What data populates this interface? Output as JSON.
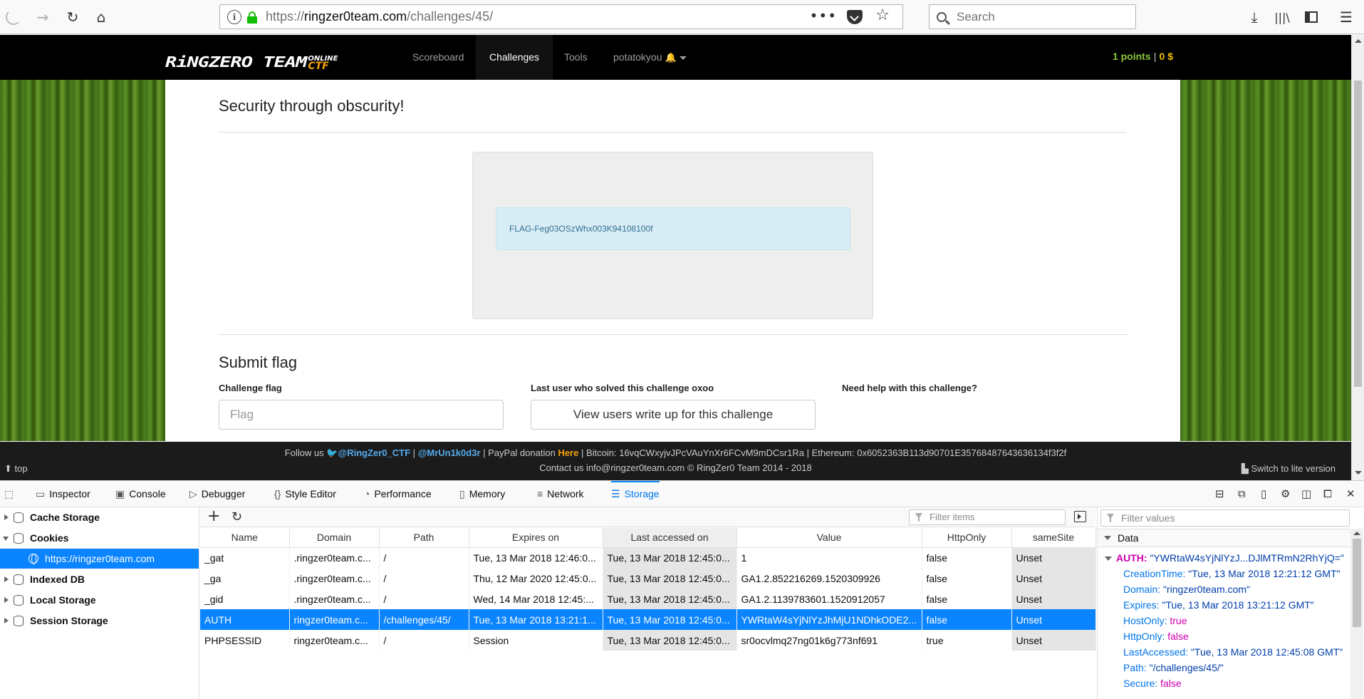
{
  "browser": {
    "url_prefix": "https://",
    "url_host": "ringzer0team.com",
    "url_path": "/challenges/45/",
    "search_placeholder": "Search",
    "url_more": "•••"
  },
  "site": {
    "logo_main": "RiNGZERO TEAM",
    "logo_online": "ONLINE",
    "logo_ctf": "CTF",
    "nav": [
      {
        "label": "Scoreboard"
      },
      {
        "label": "Challenges"
      },
      {
        "label": "Tools"
      },
      {
        "label": "potatokyou"
      }
    ],
    "points": "1 points",
    "points_sep": "|",
    "money": "0 $",
    "challenge_title": "Security through obscurity!",
    "flag_text": "FLAG-Feg03OSzWhx003K94108100f",
    "submit_title": "Submit flag",
    "challenge_flag_label": "Challenge flag",
    "flag_placeholder": "Flag",
    "last_user_label": "Last user who solved this challenge",
    "last_user": "oxoo",
    "need_help_label": "Need help with this challenge?",
    "writeup_button": "View users write up for this challenge"
  },
  "footer": {
    "follow": "Follow us",
    "twitter1": "@RingZer0_CTF",
    "sep": "|",
    "twitter2": "@MrUn1k0d3r",
    "paypal": "| PayPal donation",
    "here": "Here",
    "bitcoin": "| Bitcoin: 16vqCWxyjvJPcVAuYnXr6FCvM9mDCsr1Ra | Ethereum: 0x6052363B113d90701E35768487643636134f3f2f",
    "contact": "Contact us info@ringzer0team.com © RingZer0 Team 2014 - 2018",
    "top": "top",
    "lite": "Switch to lite version"
  },
  "devtools": {
    "tabs": [
      {
        "label": "Inspector",
        "icon": "inspector-icon"
      },
      {
        "label": "Console",
        "icon": "console-icon"
      },
      {
        "label": "Debugger",
        "icon": "debugger-icon"
      },
      {
        "label": "Style Editor",
        "icon": "style-editor-icon"
      },
      {
        "label": "Performance",
        "icon": "performance-icon"
      },
      {
        "label": "Memory",
        "icon": "memory-icon"
      },
      {
        "label": "Network",
        "icon": "network-icon"
      },
      {
        "label": "Storage",
        "icon": "storage-icon"
      }
    ],
    "sidebar": {
      "cache_storage": "Cache Storage",
      "cookies": "Cookies",
      "cookie_host": "https://ringzer0team.com",
      "indexed_db": "Indexed DB",
      "local_storage": "Local Storage",
      "session_storage": "Session Storage"
    },
    "filter_items_placeholder": "Filter items",
    "filter_values_placeholder": "Filter values",
    "columns": [
      "Name",
      "Domain",
      "Path",
      "Expires on",
      "Last accessed on",
      "Value",
      "HttpOnly",
      "sameSite"
    ],
    "rows": [
      {
        "name": "_gat",
        "domain": ".ringzer0team.c...",
        "path": "/",
        "expires": "Tue, 13 Mar 2018 12:46:0...",
        "accessed": "Tue, 13 Mar 2018 12:45:0...",
        "value": "1",
        "httponly": "false",
        "samesite": "Unset"
      },
      {
        "name": "_ga",
        "domain": ".ringzer0team.c...",
        "path": "/",
        "expires": "Thu, 12 Mar 2020 12:45:0...",
        "accessed": "Tue, 13 Mar 2018 12:45:0...",
        "value": "GA1.2.852216269.1520309926",
        "httponly": "false",
        "samesite": "Unset"
      },
      {
        "name": "_gid",
        "domain": ".ringzer0team.c...",
        "path": "/",
        "expires": "Wed, 14 Mar 2018 12:45:...",
        "accessed": "Tue, 13 Mar 2018 12:45:0...",
        "value": "GA1.2.1139783601.1520912057",
        "httponly": "false",
        "samesite": "Unset"
      },
      {
        "name": "AUTH",
        "domain": "ringzer0team.c...",
        "path": "/challenges/45/",
        "expires": "Tue, 13 Mar 2018 13:21:1...",
        "accessed": "Tue, 13 Mar 2018 12:45:0...",
        "value": "YWRtaW4sYjNlYzJhMjU1NDhkODE2...",
        "httponly": "false",
        "samesite": "Unset"
      },
      {
        "name": "PHPSESSID",
        "domain": "ringzer0team.c...",
        "path": "/",
        "expires": "Session",
        "accessed": "Tue, 13 Mar 2018 12:45:0...",
        "value": "sr0ocvlmq27ng01k6g773nf691",
        "httponly": "true",
        "samesite": "Unset"
      }
    ],
    "data_header": "Data",
    "data": {
      "root_key": "AUTH:",
      "root_val": "\"YWRtaW4sYjNlYzJ...DJlMTRmN2RhYjQ=\"",
      "items": [
        {
          "k": "CreationTime:",
          "v": "\"Tue, 13 Mar 2018 12:21:12 GMT\"",
          "type": "str"
        },
        {
          "k": "Domain:",
          "v": "\"ringzer0team.com\"",
          "type": "str"
        },
        {
          "k": "Expires:",
          "v": "\"Tue, 13 Mar 2018 13:21:12 GMT\"",
          "type": "str"
        },
        {
          "k": "HostOnly:",
          "v": "true",
          "type": "bool"
        },
        {
          "k": "HttpOnly:",
          "v": "false",
          "type": "bool"
        },
        {
          "k": "LastAccessed:",
          "v": "\"Tue, 13 Mar 2018 12:45:08 GMT\"",
          "type": "str"
        },
        {
          "k": "Path:",
          "v": "\"/challenges/45/\"",
          "type": "str"
        },
        {
          "k": "Secure:",
          "v": "false",
          "type": "bool"
        }
      ]
    }
  }
}
